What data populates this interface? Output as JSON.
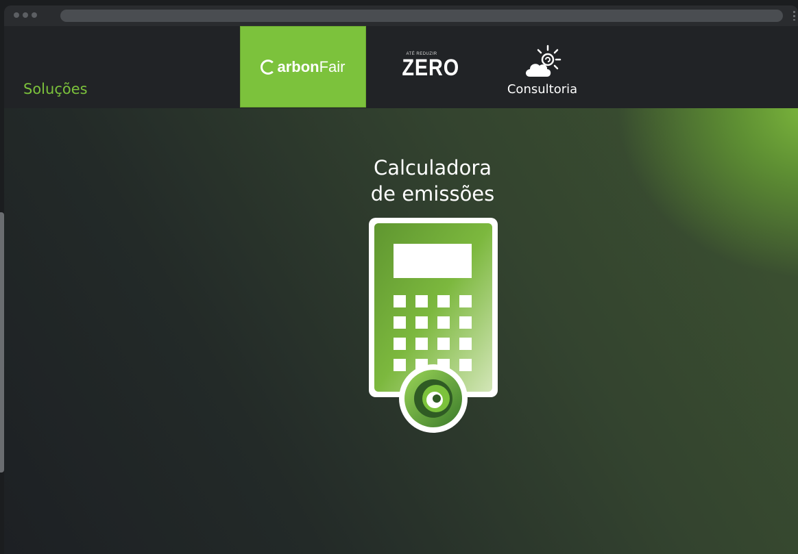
{
  "nav": {
    "section_label": "Soluções",
    "tabs": [
      {
        "brand_part1": "arbon",
        "brand_part2": "Fair",
        "active": true
      },
      {
        "tagline": "ATÉ REDUZIR",
        "brand": "ZERO",
        "active": false
      },
      {
        "label": "Consultoria",
        "icon": "sun-cloud-icon",
        "active": false
      }
    ]
  },
  "hero": {
    "title_line1": "Calculadora",
    "title_line2": "de emissões",
    "icon": "calculator-icon"
  },
  "colors": {
    "accent": "#7cc23c",
    "nav_bg": "#212326",
    "page_bg": "#1b1d1f"
  }
}
